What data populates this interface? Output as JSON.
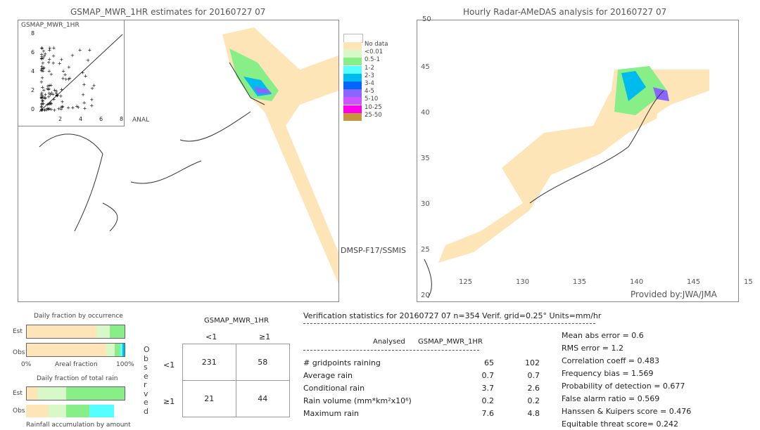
{
  "left_map": {
    "title": "GSMAP_MWR_1HR estimates for 20160727 07",
    "inset_title": "GSMAP_MWR_1HR",
    "inset_xlabel": "ANAL",
    "inset_ticks": [
      "0",
      "2",
      "4",
      "6",
      "8"
    ],
    "sensor": "DMSP-F17/SSMIS"
  },
  "right_map": {
    "title": "Hourly Radar-AMeDAS analysis for 20160727 07",
    "credit": "Provided by:JWA/JMA",
    "lat_labels": [
      "45",
      "40",
      "35",
      "30",
      "25",
      "20"
    ],
    "lon_labels": [
      "125",
      "130",
      "135",
      "140",
      "145",
      "15"
    ],
    "top_label": "50"
  },
  "legend": {
    "items": [
      {
        "label": "No data",
        "color": "#fde5b8"
      },
      {
        "label": "<0.01",
        "color": "#d8f8c8"
      },
      {
        "label": "0.5-1",
        "color": "#88ee88"
      },
      {
        "label": "1-2",
        "color": "#55ffff"
      },
      {
        "label": "2-3",
        "color": "#00bbee"
      },
      {
        "label": "3-4",
        "color": "#0066ff"
      },
      {
        "label": "4-5",
        "color": "#8866ff"
      },
      {
        "label": "5-10",
        "color": "#cc55ff"
      },
      {
        "label": "10-25",
        "color": "#ff00ee"
      },
      {
        "label": "25-50",
        "color": "#c8963c"
      }
    ]
  },
  "fractions": {
    "occurrence_title": "Daily fraction by occurrence",
    "est": "Est",
    "obs": "Obs",
    "axis_left": "0%",
    "axis_mid": "Areal fraction",
    "axis_right": "100%",
    "rain_title": "Daily fraction of total rain",
    "accum_title": "Rainfall accumulation by amount",
    "occ_est": [
      0.71,
      0.14,
      0.15
    ],
    "occ_obs": [
      0.81,
      0.09,
      0.06,
      0.02,
      0.02
    ],
    "rain_est": [
      0.11,
      0.29,
      0.6
    ],
    "rain_obs": [
      0.23,
      0.18,
      0.24,
      0.25
    ]
  },
  "contingency": {
    "title": "GSMAP_MWR_1HR",
    "col_labels": [
      "<1",
      "≥1"
    ],
    "row_labels": [
      "<1",
      "≥1"
    ],
    "side_label": "Observed",
    "cells": [
      [
        "231",
        "58"
      ],
      [
        "21",
        "44"
      ]
    ]
  },
  "stats": {
    "header": "Verification statistics for 20160727 07  n=354  Verif. grid=0.25°  Units=mm/hr",
    "col1": "Analysed",
    "col2": "GSMAP_MWR_1HR",
    "rows": [
      {
        "label": "# gridpoints raining",
        "a": "65",
        "b": "102"
      },
      {
        "label": "Average rain",
        "a": "0.7",
        "b": "0.7"
      },
      {
        "label": "Conditional rain",
        "a": "3.7",
        "b": "2.6"
      },
      {
        "label": "Rain volume (mm*km²x10⁶)",
        "a": "0.2",
        "b": "0.2"
      },
      {
        "label": "Maximum rain",
        "a": "7.6",
        "b": "4.8"
      }
    ],
    "scores": [
      "Mean abs error = 0.6",
      "RMS error = 1.2",
      "Correlation coeff = 0.483",
      "Frequency bias = 1.569",
      "Probability of detection = 0.677",
      "False alarm ratio = 0.569",
      "Hanssen & Kuipers score = 0.476",
      "Equitable threat score= 0.242"
    ]
  }
}
